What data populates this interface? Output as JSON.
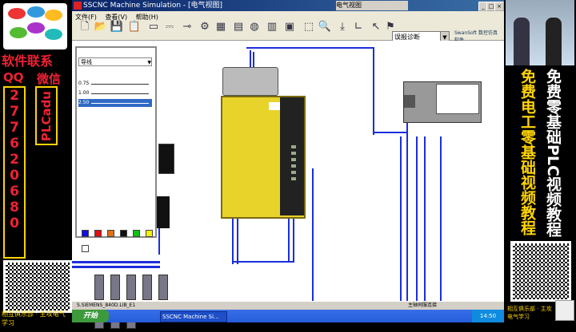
{
  "left_panel": {
    "title": "软件联系",
    "qq_label": "QQ",
    "wechat_label": "微信",
    "qq_digits": [
      "2",
      "7",
      "7",
      "6",
      "2",
      "0",
      "6",
      "8",
      "0"
    ],
    "wechat_id": "PLCadu",
    "bottom_text": "相互俱乐部 · 主攻电气学习"
  },
  "window": {
    "title": "SSCNC Machine Simulation - [电气视图]",
    "inner_title": "电气视图",
    "menu": [
      "文件(F)",
      "查看(V)",
      "帮助(H)"
    ],
    "combo_value": "误报诊断",
    "brand": "SwanSoft 数控仿真软件",
    "props_panel": {
      "combo": "导线",
      "rows": [
        "0.75",
        "1.00",
        "2.50"
      ],
      "selected_index": 2,
      "swatch_colors": [
        "#1010e0",
        "#e01010",
        "#e07010",
        "#101010",
        "#10c010",
        "#f0f000",
        "#ffffff"
      ]
    },
    "status_left": "S.SIEMENS_840D.LIB_E1",
    "status_right": "主轴伺服连接",
    "taskbar": {
      "start": "开始",
      "task": "SSCNC Machine Si...",
      "clock": "14:50"
    }
  },
  "right_panel": {
    "text1": "免费电工零基础视频教程",
    "text2": "免费零基础PLC视频教程",
    "bottom_text": "相互俱乐部 · 主攻电气学习"
  },
  "colors": {
    "wire": "#1a2edb",
    "promo_red": "#e22233",
    "promo_yellow": "#ffd400"
  }
}
